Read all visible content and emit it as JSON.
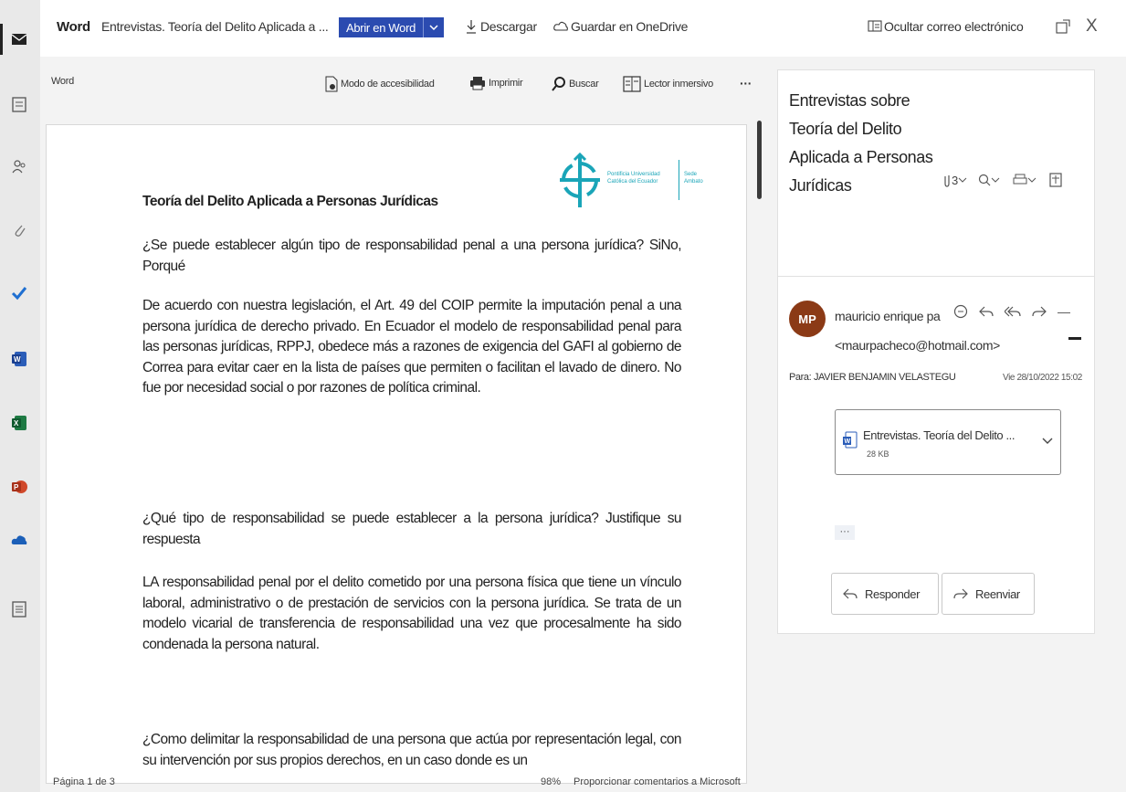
{
  "topbar": {
    "app_name": "Word",
    "doc_title": "Entrevistas. Teoría del Delito Aplicada a ...",
    "open_in_word": "Abrir en Word",
    "download": "Descargar",
    "save_onedrive": "Guardar en OneDrive",
    "hide_email": "Ocultar correo electrónico",
    "close": "X"
  },
  "doc_toolbar": {
    "word_label": "Word",
    "accessibility": "Modo de accesibilidad",
    "print": "Imprimir",
    "search": "Buscar",
    "reader": "Lector inmersivo",
    "more": "···"
  },
  "document": {
    "logo_text_1": "Pontificia Universidad\nCatólica del Ecuador",
    "logo_text_2": "Sede\nAmbato",
    "heading": "Teoría del Delito Aplicada a Personas Jurídicas",
    "q1": "¿Se puede establecer algún tipo de responsabilidad penal a una persona jurídica? SiNo, Porqué",
    "a1": "De acuerdo con nuestra legislación, el Art. 49 del COIP permite la imputación penal a una persona jurídica de derecho privado. En Ecuador el modelo de responsabilidad penal para las personas jurídicas, RPPJ, obedece más a razones de exigencia del GAFI al gobierno de Correa para evitar caer en la lista de países que permiten o facilitan el lavado de dinero. No fue por necesidad social o por razones de política criminal.",
    "q2": "¿Qué tipo de responsabilidad se puede establecer a la persona jurídica? Justifique su respuesta",
    "a2": "LA responsabilidad penal por el delito cometido por una persona física que tiene un vínculo laboral, administrativo o de prestación de servicios con la persona jurídica. Se trata de un modelo vicarial de transferencia de responsabilidad una vez que procesalmente ha sido condenada la persona natural.",
    "q3": "¿Como delimitar la responsabilidad de una persona que actúa por representación legal, con su intervención por sus propios derechos, en un caso donde es un"
  },
  "statusbar": {
    "page": "Página 1 de 3",
    "zoom": "98%",
    "feedback": "Proporcionar comentarios a Microsoft"
  },
  "email": {
    "subject": "Entrevistas sobre Teoría del Delito Aplicada a Personas Jurídicas",
    "count": "3",
    "avatar": "MP",
    "sender_name": "mauricio enrique pa",
    "sender_email": "<maurpacheco@hotmail.com>",
    "to": "Para: JAVIER BENJAMIN VELASTEGU",
    "date": "Vie 28/10/2022 15:02",
    "attachment_name": "Entrevistas. Teoría del Delito ...",
    "attachment_size": "28 KB",
    "ellipsis": "···",
    "reply": "Responder",
    "forward": "Reenviar"
  },
  "colors": {
    "accent": "#2b4bb0",
    "avatar": "#8b3a16"
  }
}
